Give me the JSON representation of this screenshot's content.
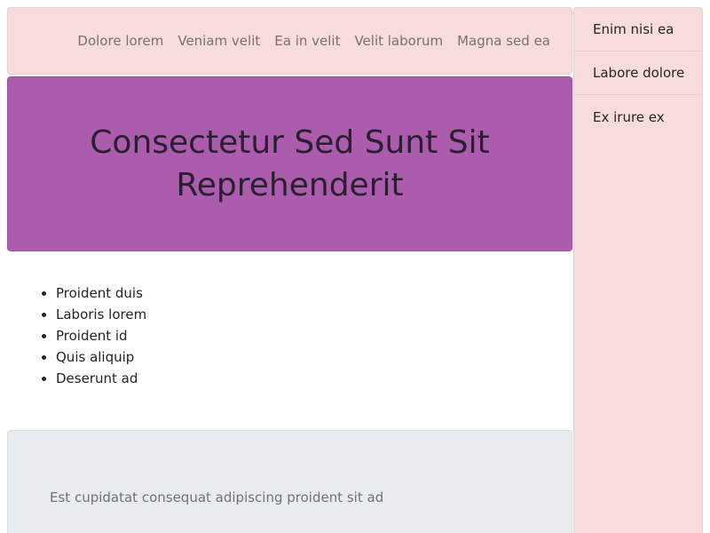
{
  "nav": {
    "links": [
      "Dolore lorem",
      "Veniam velit",
      "Ea in velit",
      "Velit laborum",
      "Magna sed ea"
    ]
  },
  "hero": {
    "title": "Consectetur Sed Sunt Sit Reprehenderit"
  },
  "list": {
    "items": [
      "Proident duis",
      "Laboris lorem",
      "Proident id",
      "Quis aliquip",
      "Deserunt ad"
    ]
  },
  "footer": {
    "text": "Est cupidatat consequat adipiscing proident sit ad"
  },
  "sidebar": {
    "items": [
      "Enim nisi ea",
      "Labore dolore",
      "Ex irure ex"
    ]
  },
  "colors": {
    "nav_bg": "#f8dcdc",
    "hero_bg": "#ab5cac",
    "footer_bg": "#e8ebef",
    "sidebar_bg": "#f8dcdc"
  }
}
